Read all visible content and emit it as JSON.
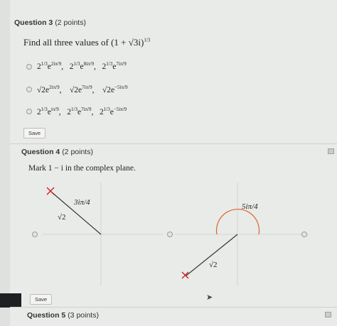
{
  "q3": {
    "title": "Question 3",
    "points": "(2 points)",
    "prompt": "Find all three values of (1 + √3i)",
    "prompt_exp": "1/3",
    "options": [
      {
        "a": "2",
        "a_exp": "1/3",
        "a_e": "e",
        "a_e_exp": "2iπ/9",
        "b": "2",
        "b_exp": "1/3",
        "b_e": "e",
        "b_e_exp": "8iπ/9",
        "c": "2",
        "c_exp": "1/3",
        "c_e": "e",
        "c_e_exp": "7iπ/9"
      },
      {
        "a": "√2e",
        "a_exp": "2iπ/9",
        "b": "√2e",
        "b_exp": "7iπ/9",
        "c": "√2e",
        "c_exp": "−5iπ/9"
      },
      {
        "a": "2",
        "a_exp": "1/3",
        "a_e": "e",
        "a_e_exp": "iπ/9",
        "b": "2",
        "b_exp": "1/3",
        "b_e": "e",
        "b_e_exp": "7iπ/9",
        "c": "2",
        "c_exp": "1/3",
        "c_e": "e",
        "c_e_exp": "−5iπ/9"
      }
    ],
    "save": "Save"
  },
  "q4": {
    "title": "Question 4",
    "points": "(2 points)",
    "prompt": "Mark 1 − i in the complex plane.",
    "opt1_angle": "3iπ/4",
    "opt1_mod": "√2",
    "opt2_angle": "5iπ/4",
    "opt2_mod": "√2",
    "save": "Save"
  },
  "q5": {
    "title": "Question 5",
    "points": "(3 points)"
  }
}
